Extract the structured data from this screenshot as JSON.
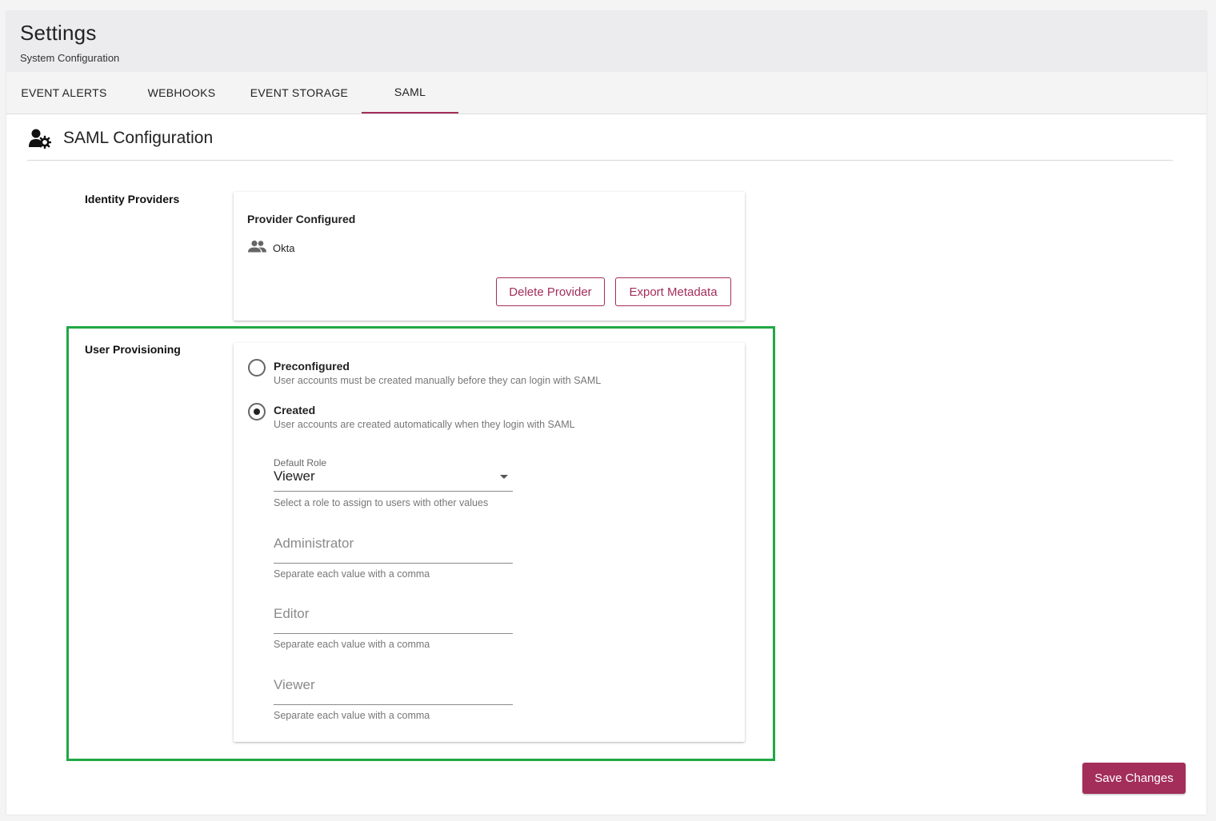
{
  "header": {
    "title": "Settings",
    "subtitle": "System Configuration"
  },
  "tabs": [
    {
      "label": "EVENT ALERTS",
      "active": false
    },
    {
      "label": "WEBHOOKS",
      "active": false
    },
    {
      "label": "EVENT STORAGE",
      "active": false
    },
    {
      "label": "SAML",
      "active": true
    }
  ],
  "section": {
    "title": "SAML Configuration",
    "icon": "user-gear-icon"
  },
  "identity_providers": {
    "label": "Identity Providers",
    "card_title": "Provider Configured",
    "provider_icon": "people-icon",
    "provider_name": "Okta",
    "delete_label": "Delete Provider",
    "export_label": "Export Metadata"
  },
  "user_provisioning": {
    "label": "User Provisioning",
    "options": [
      {
        "label": "Preconfigured",
        "description": "User accounts must be created manually before they can login with SAML",
        "selected": false
      },
      {
        "label": "Created",
        "description": "User accounts are created automatically when they login with SAML",
        "selected": true
      }
    ],
    "default_role": {
      "label": "Default Role",
      "value": "Viewer",
      "helper": "Select a role to assign to users with other values"
    },
    "role_fields": [
      {
        "placeholder": "Administrator",
        "helper": "Separate each value with a comma"
      },
      {
        "placeholder": "Editor",
        "helper": "Separate each value with a comma"
      },
      {
        "placeholder": "Viewer",
        "helper": "Separate each value with a comma"
      }
    ]
  },
  "save_label": "Save Changes",
  "colors": {
    "accent": "#a32e5a",
    "highlight": "#21a844"
  }
}
